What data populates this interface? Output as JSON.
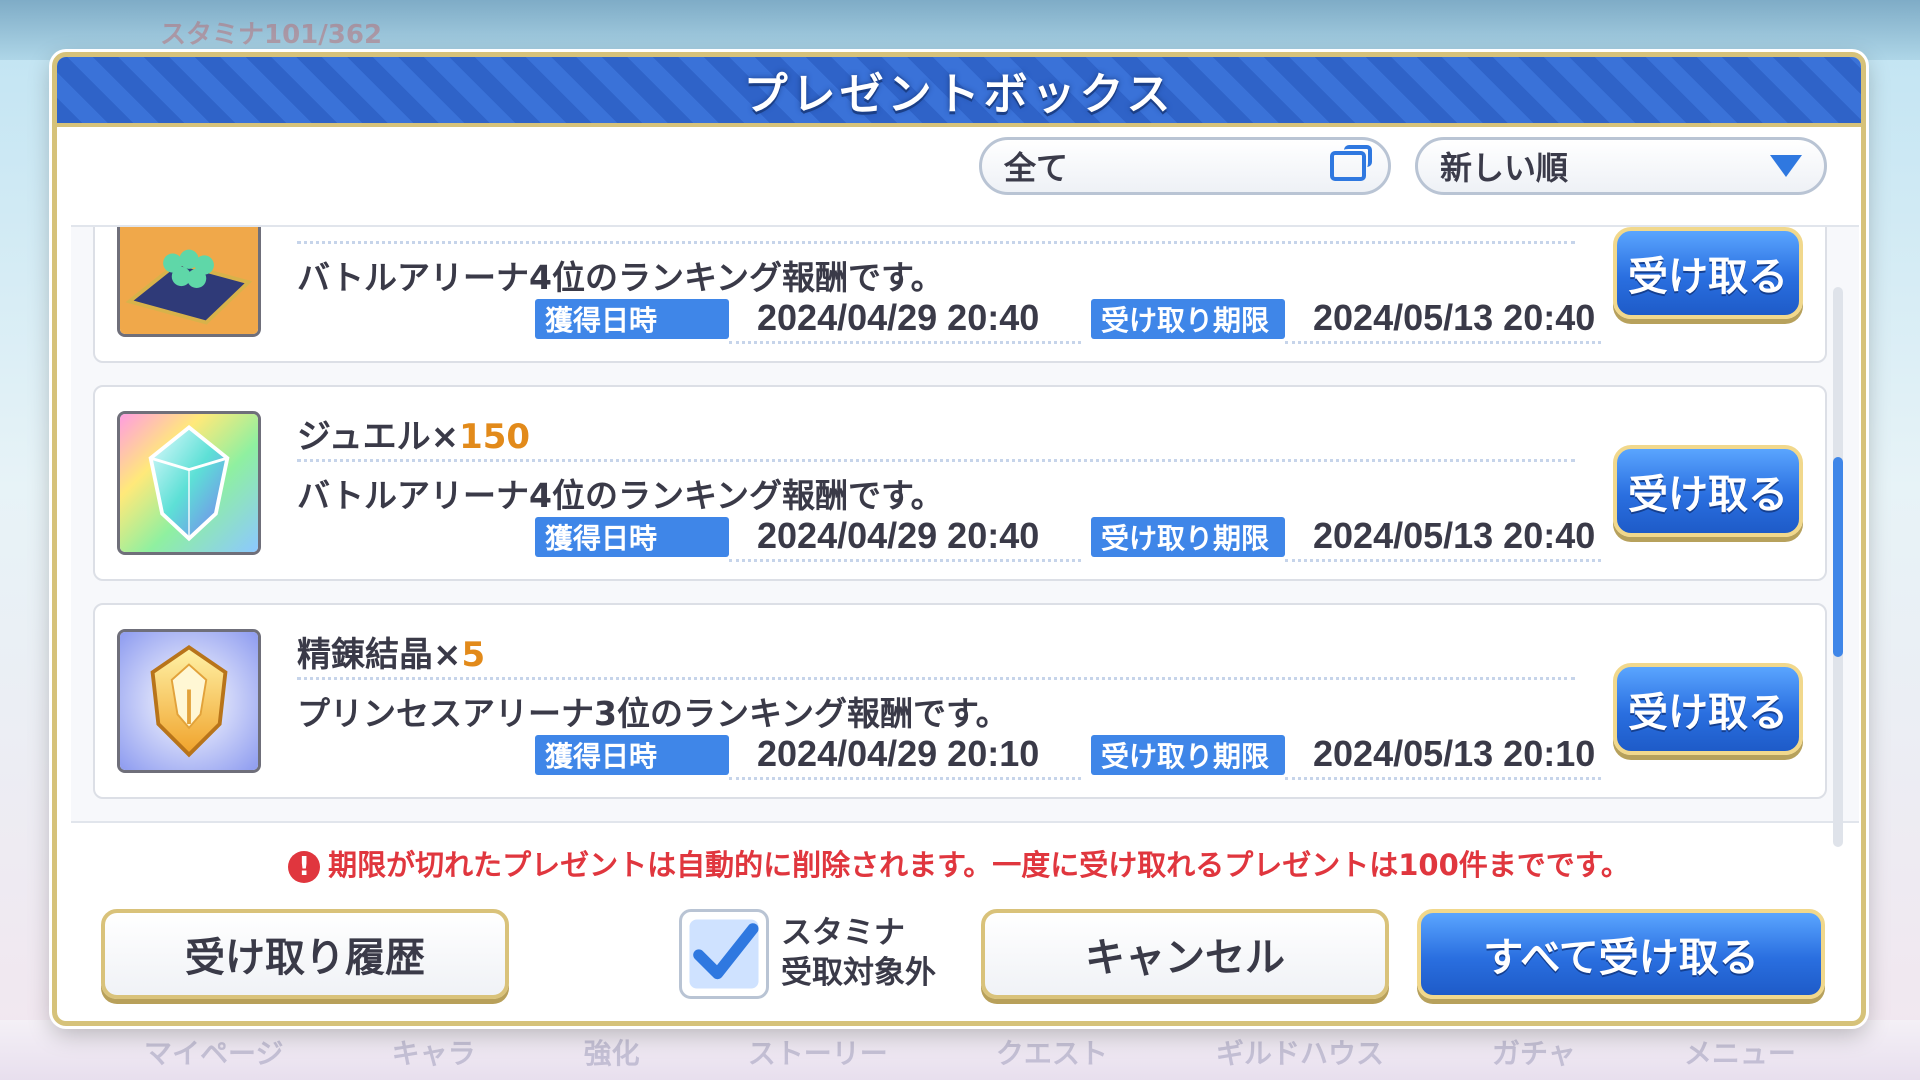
{
  "background": {
    "stamina_text": "スタミナ101/362",
    "nav": [
      "マイページ",
      "キャラ",
      "強化",
      "ストーリー",
      "クエスト",
      "ギルドハウス",
      "ガチャ",
      "メニュー"
    ]
  },
  "dialog": {
    "title": "プレゼントボックス",
    "filter": {
      "category": "全て",
      "sort": "新しい順"
    },
    "labels": {
      "acquired": "獲得日時",
      "deadline": "受け取り期限",
      "receive": "受け取る"
    },
    "items": [
      {
        "icon": "mana-gem-pile-icon",
        "name": "",
        "qty": "",
        "desc": "バトルアリーナ4位のランキング報酬です。",
        "acquired": "2024/04/29 20:40",
        "deadline": "2024/05/13 20:40"
      },
      {
        "icon": "rainbow-jewel-icon",
        "name": "ジュエル×",
        "qty": "150",
        "desc": "バトルアリーナ4位のランキング報酬です。",
        "acquired": "2024/04/29 20:40",
        "deadline": "2024/05/13 20:40"
      },
      {
        "icon": "refine-crystal-icon",
        "name": "精錬結晶×",
        "qty": "5",
        "desc": "プリンセスアリーナ3位のランキング報酬です。",
        "acquired": "2024/04/29 20:10",
        "deadline": "2024/05/13 20:10"
      }
    ],
    "notice": "期限が切れたプレゼントは自動的に削除されます。一度に受け取れるプレゼントは100件までです。",
    "buttons": {
      "history": "受け取り履歴",
      "cancel": "キャンセル",
      "receive_all": "すべて受け取る"
    },
    "checkbox": {
      "line1": "スタミナ",
      "line2": "受取対象外",
      "checked": true
    }
  }
}
